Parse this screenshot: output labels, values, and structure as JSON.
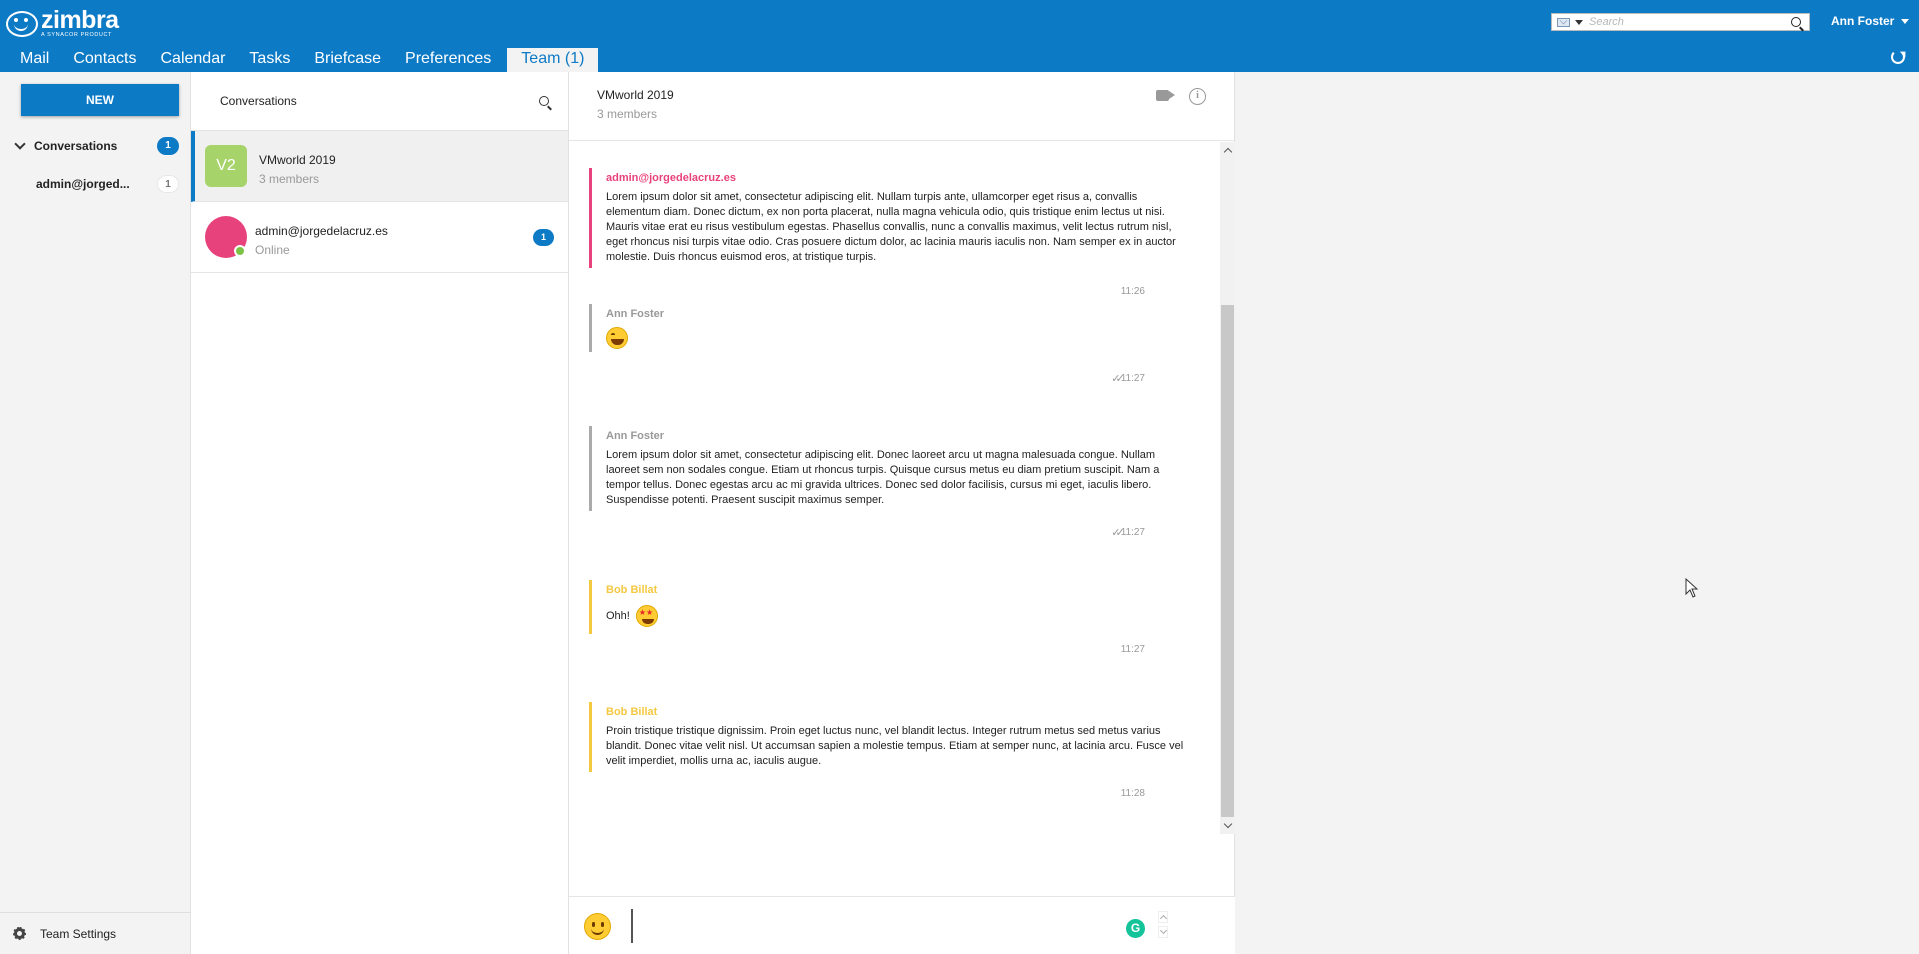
{
  "header": {
    "logo_name": "zimbra",
    "logo_sub": "A SYNACOR PRODUCT",
    "search_placeholder": "Search",
    "user_name": "Ann Foster",
    "tabs": [
      {
        "label": "Mail"
      },
      {
        "label": "Contacts"
      },
      {
        "label": "Calendar"
      },
      {
        "label": "Tasks"
      },
      {
        "label": "Briefcase"
      },
      {
        "label": "Preferences"
      },
      {
        "label": "Team (1)"
      }
    ],
    "active_tab": "Team (1)"
  },
  "sidebar": {
    "new_label": "NEW",
    "conversations_label": "Conversations",
    "conversations_count": "1",
    "items": [
      {
        "label": "admin@jorged...",
        "count": "1"
      }
    ],
    "settings_label": "Team Settings"
  },
  "convlist": {
    "title": "Conversations",
    "rows": [
      {
        "avatar_text": "V2",
        "name": "VMworld 2019",
        "sub": "3 members",
        "badge": ""
      },
      {
        "avatar_text": "",
        "name": "admin@jorgedelacruz.es",
        "sub": "Online",
        "badge": "1"
      }
    ]
  },
  "chat": {
    "title": "VMworld 2019",
    "sub": "3 members",
    "messages": [
      {
        "author": "admin@jorgedelacruz.es",
        "text": "Lorem ipsum dolor sit amet, consectetur adipiscing elit. Nullam turpis ante, ullamcorper eget risus a, convallis elementum diam. Donec dictum, ex non porta placerat, nulla magna vehicula odio, quis tristique enim lectus ut nisi. Mauris vitae erat eu risus vestibulum egestas. Phasellus convallis, nunc a convallis maximus, velit lectus rutrum nisl, eget rhoncus nisi turpis vitae odio. Cras posuere dictum dolor, ac lacinia mauris iaculis non. Nam semper ex in auctor molestie. Duis rhoncus euismod eros, at tristique turpis.",
        "time": "11:26"
      },
      {
        "author": "Ann Foster",
        "text": "",
        "emoji": "laughing-emoji",
        "time": "11:27"
      },
      {
        "author": "Ann Foster",
        "text": "Lorem ipsum dolor sit amet, consectetur adipiscing elit. Donec laoreet arcu ut magna malesuada congue. Nullam laoreet sem non sodales congue. Etiam ut rhoncus turpis. Quisque cursus metus eu diam pretium suscipit. Nam a tempor tellus. Donec egestas arcu ac mi gravida ultrices. Donec sed dolor facilisis, cursus mi eget, iaculis libero. Suspendisse potenti. Praesent suscipit maximus semper.",
        "time": "11:27"
      },
      {
        "author": "Bob Billat",
        "text": "Ohh!",
        "emoji": "star-struck-emoji",
        "time": "11:27"
      },
      {
        "author": "Bob Billat",
        "text": "Proin tristique tristique dignissim. Proin eget luctus nunc, vel blandit lectus. Integer rutrum metus sed metus varius blandit. Donec vitae velit nisl. Ut accumsan sapien a molestie tempus. Etiam at semper nunc, at lacinia arcu. Fusce vel velit imperdiet, mollis urna ac, iaculis augue.",
        "time": "11:28"
      }
    ],
    "composer_placeholder": ""
  },
  "colors": {
    "brand": "#0d7ac6",
    "admin": "#e8427c",
    "ann": "#999999",
    "bob": "#f5c842",
    "online": "#7cc245"
  }
}
